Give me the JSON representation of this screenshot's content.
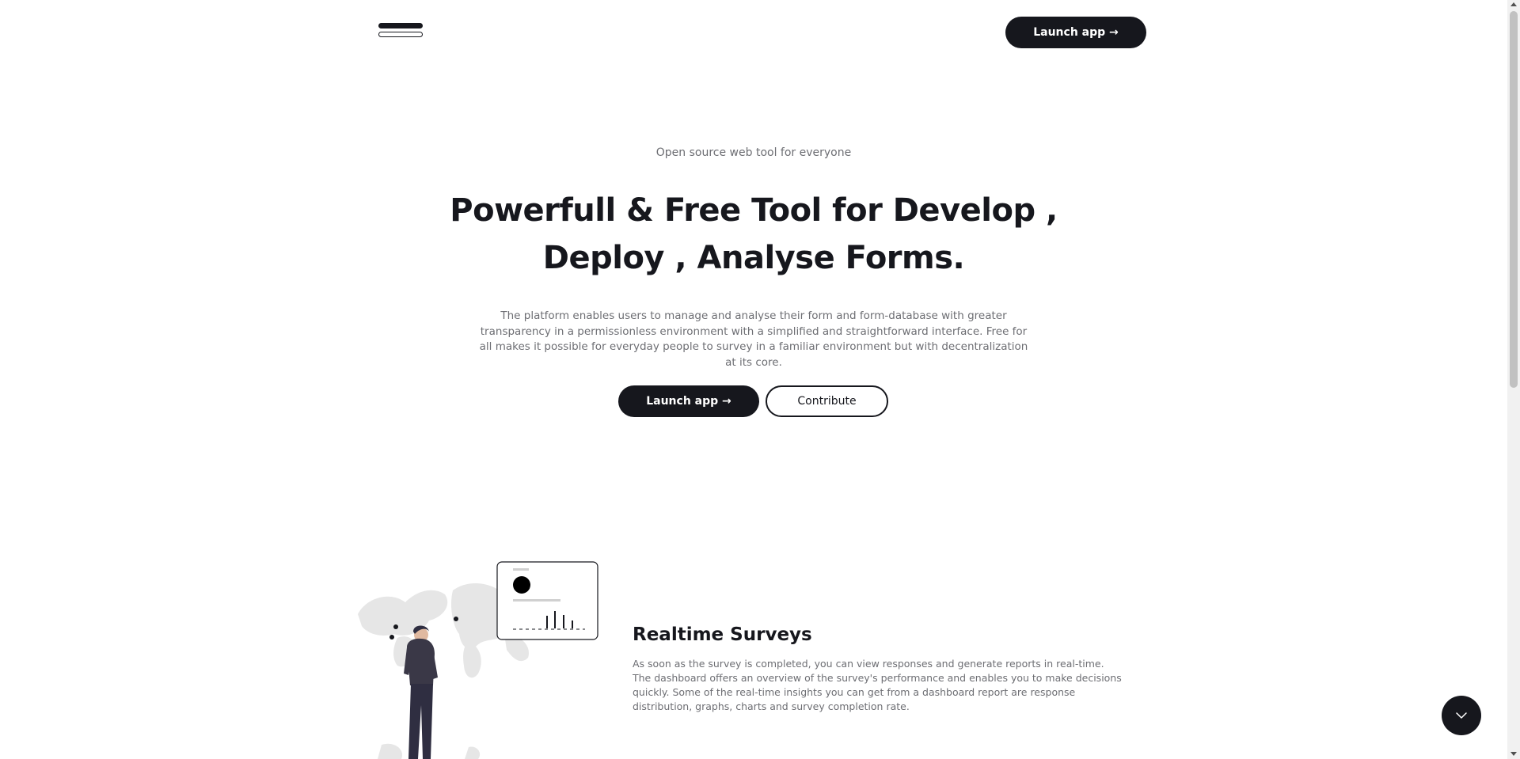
{
  "header": {
    "logo_icon": "menu-bars-logo-icon",
    "launch_label": "Launch app →"
  },
  "hero": {
    "eyebrow": "Open source web tool for everyone",
    "title": "Powerfull & Free Tool for Develop , Deploy , Analyse Forms.",
    "description": "The platform enables users to manage and analyse their form and form-database with greater transparency in a permissionless environment with a simplified and straightforward interface. Free for all makes it possible for everyday people to survey in a familiar environment but with decentralization at its core.",
    "launch_label": "Launch app →",
    "contribute_label": "Contribute"
  },
  "feature": {
    "title": "Realtime Surveys",
    "description": "As soon as the survey is completed, you can view responses and generate reports in real-time. The dashboard offers an overview of the survey's performance and enables you to make decisions quickly. Some of the real-time insights you can get from a dashboard report are response distribution, graphs, charts and survey completion rate.",
    "illustration": "person-looking-at-world-map-dashboard-illustration"
  },
  "scroll_button": {
    "icon": "chevron-down-icon"
  },
  "colors": {
    "primary": "#16171d",
    "muted_text": "#6d6e73",
    "background": "#ffffff"
  }
}
